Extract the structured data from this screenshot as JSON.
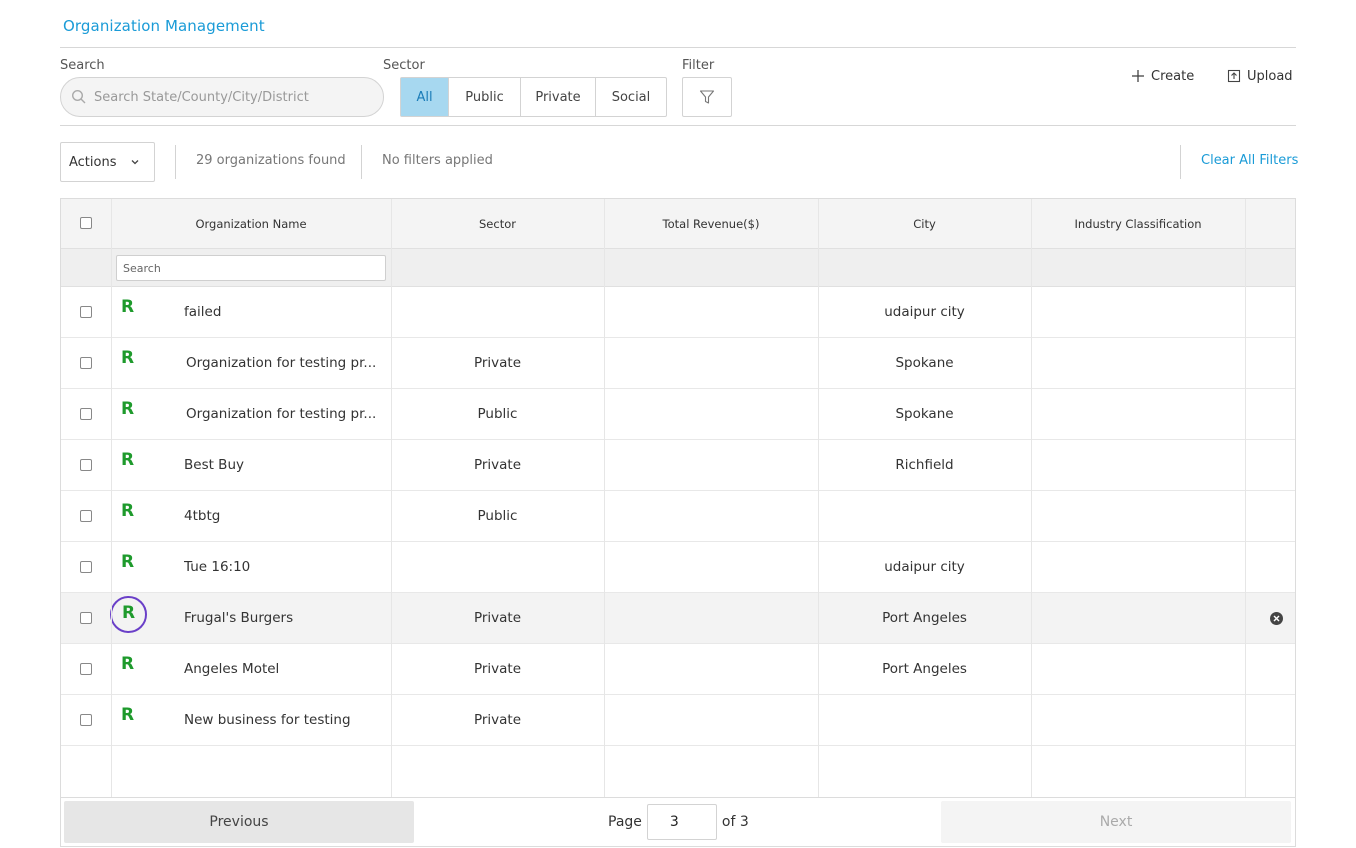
{
  "page_title": "Organization Management",
  "search": {
    "label": "Search",
    "placeholder": "Search State/County/City/District"
  },
  "sector_filter": {
    "label": "Sector",
    "options": [
      "All",
      "Public",
      "Private",
      "Social"
    ],
    "selected": "All"
  },
  "filter": {
    "label": "Filter"
  },
  "header_actions": {
    "create_label": "Create",
    "upload_label": "Upload"
  },
  "toolbar": {
    "actions_label": "Actions",
    "result_count": "29 organizations found",
    "filter_status": "No filters applied",
    "clear_filters_label": "Clear All Filters"
  },
  "table": {
    "columns": [
      "Organization Name",
      "Sector",
      "Total Revenue($)",
      "City",
      "Industry Classification"
    ],
    "column_search_placeholder": "Search",
    "rows": [
      {
        "marker": "R",
        "name": "failed",
        "sector": "",
        "revenue": "",
        "city": "udaipur city",
        "industry": ""
      },
      {
        "marker": "R",
        "name": "Organization for testing pr...",
        "sector": "Private",
        "revenue": "",
        "city": "Spokane",
        "industry": ""
      },
      {
        "marker": "R",
        "name": "Organization for testing pr...",
        "sector": "Public",
        "revenue": "",
        "city": "Spokane",
        "industry": ""
      },
      {
        "marker": "R",
        "name": "Best Buy",
        "sector": "Private",
        "revenue": "",
        "city": "Richfield",
        "industry": ""
      },
      {
        "marker": "R",
        "name": "4tbtg",
        "sector": "Public",
        "revenue": "",
        "city": "",
        "industry": ""
      },
      {
        "marker": "R",
        "name": "Tue 16:10",
        "sector": "",
        "revenue": "",
        "city": "udaipur city",
        "industry": ""
      },
      {
        "marker": "R",
        "name": "Frugal's Burgers",
        "sector": "Private",
        "revenue": "",
        "city": "Port Angeles",
        "industry": ""
      },
      {
        "marker": "R",
        "name": "Angeles Motel",
        "sector": "Private",
        "revenue": "",
        "city": "Port Angeles",
        "industry": ""
      },
      {
        "marker": "R",
        "name": "New business for testing",
        "sector": "Private",
        "revenue": "",
        "city": "",
        "industry": ""
      }
    ]
  },
  "pagination": {
    "previous_label": "Previous",
    "next_label": "Next",
    "page_label": "Page",
    "current_page": "3",
    "of_label": "of 3"
  },
  "colors": {
    "accent": "#1a9bd7",
    "marker_green": "#1e9a2c",
    "focus_ring": "#6a3fc8",
    "active_segment": "#a7d8f0"
  }
}
